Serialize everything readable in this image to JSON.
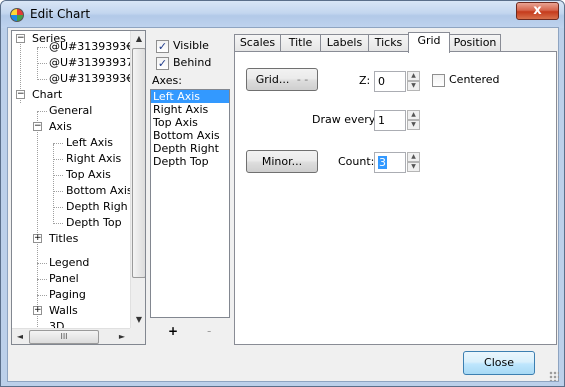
{
  "window": {
    "title": "Edit Chart",
    "close_glyph": "x"
  },
  "tree": {
    "nodes": [
      {
        "label": "Series",
        "expander": "−"
      },
      {
        "label": "@U#3139393€"
      },
      {
        "label": "@U#31393937"
      },
      {
        "label": "@U#3139393€"
      },
      {
        "label": "Chart",
        "expander": "−"
      },
      {
        "label": "General"
      },
      {
        "label": "Axis",
        "expander": "−"
      },
      {
        "label": "Left Axis"
      },
      {
        "label": "Right Axis"
      },
      {
        "label": "Top Axis"
      },
      {
        "label": "Bottom Axis"
      },
      {
        "label": "Depth Righ"
      },
      {
        "label": "Depth Top"
      },
      {
        "label": "Titles",
        "expander": "+"
      },
      {
        "label": "Legend"
      },
      {
        "label": "Panel"
      },
      {
        "label": "Paging"
      },
      {
        "label": "Walls",
        "expander": "+"
      },
      {
        "label": "3D"
      }
    ],
    "scroll_up": "▲",
    "scroll_down": "▼",
    "scroll_left": "◄",
    "scroll_right": "►",
    "thumb_grip": "III"
  },
  "axis_options": {
    "visible_label": "Visible",
    "visible_checked": "✓",
    "behind_label": "Behind",
    "behind_checked": "✓",
    "axes_label": "Axes:",
    "axes": [
      "Left Axis",
      "Right Axis",
      "Top Axis",
      "Bottom Axis",
      "Depth Right",
      "Depth Top"
    ],
    "selected_axis": "Left Axis",
    "add_label": "+",
    "remove_label": "-"
  },
  "tabs": [
    "Scales",
    "Title",
    "Labels",
    "Ticks",
    "Grid",
    "Position"
  ],
  "active_tab": "Grid",
  "grid_tab": {
    "grid_button": "Grid...",
    "grid_button_pattern": "- -",
    "z_label": "Z:",
    "z_value": "0",
    "centered_label": "Centered",
    "draw_every_label": "Draw every:",
    "draw_every_value": "1",
    "minor_button": "Minor...",
    "count_label": "Count:",
    "count_value": "3"
  },
  "footer": {
    "close_button": "Close"
  },
  "colors": {
    "selection": "#3399ff",
    "title_bar": "#c3d6ef",
    "close_red": "#c53b1c"
  }
}
